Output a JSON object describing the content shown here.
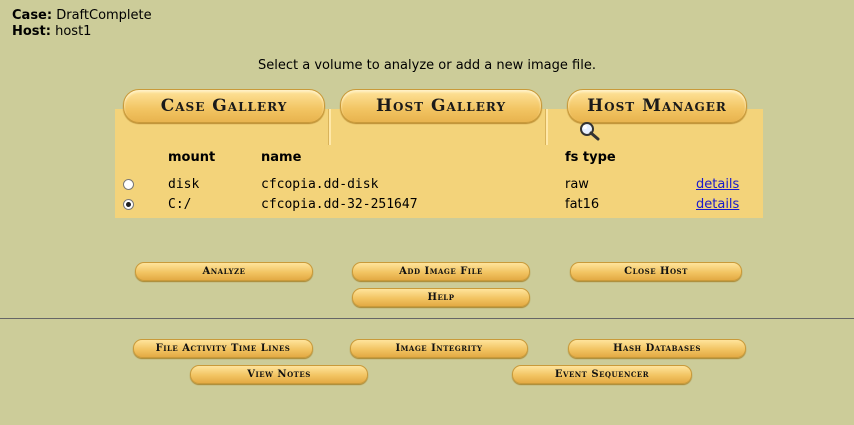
{
  "case": {
    "label": "Case:",
    "value": "DraftComplete"
  },
  "host": {
    "label": "Host:",
    "value": "host1"
  },
  "instruction": "Select a volume to analyze or add a new image file.",
  "tabs": [
    {
      "label": "Case Gallery"
    },
    {
      "label": "Host Gallery"
    },
    {
      "label": "Host Manager"
    }
  ],
  "table": {
    "headers": {
      "mount": "mount",
      "name": "name",
      "fs_type": "fs type"
    },
    "rows": [
      {
        "mount": "disk",
        "name": "cfcopia.dd-disk",
        "fs_type": "raw",
        "details": "details",
        "selected": false
      },
      {
        "mount": "C:/",
        "name": "cfcopia.dd-32-251647",
        "fs_type": "fat16",
        "details": "details",
        "selected": true
      }
    ]
  },
  "buttons": {
    "analyze": "Analyze",
    "add_image_file": "Add Image File",
    "close_host": "Close Host",
    "help": "Help",
    "file_activity": "File Activity Time Lines",
    "image_integrity": "Image Integrity",
    "hash_databases": "Hash Databases",
    "view_notes": "View Notes",
    "event_sequencer": "Event Sequencer"
  },
  "icons": {
    "host_manager": "magnifier-icon"
  },
  "colors": {
    "background": "#cccc99",
    "panel": "#f3d37a",
    "button": "#f2c462",
    "link": "#1a1acc"
  }
}
